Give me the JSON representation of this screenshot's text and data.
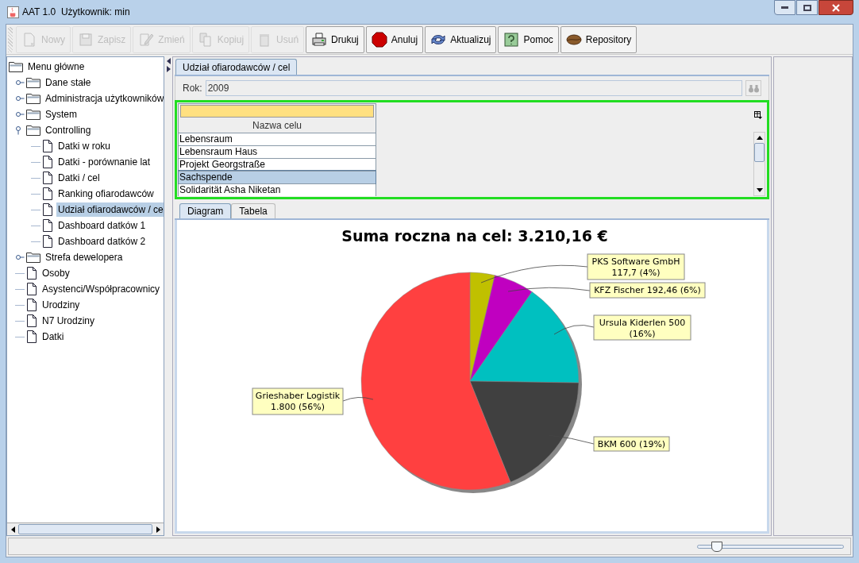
{
  "window": {
    "title": "AAT 1.0  Użytkownik: min"
  },
  "toolbar": [
    {
      "kind": "new",
      "label": "Nowy",
      "disabled": true
    },
    {
      "kind": "save",
      "label": "Zapisz",
      "disabled": true
    },
    {
      "kind": "edit",
      "label": "Zmień",
      "disabled": true
    },
    {
      "kind": "copy",
      "label": "Kopiuj",
      "disabled": true
    },
    {
      "kind": "delete",
      "label": "Usuń",
      "disabled": true
    },
    {
      "kind": "print",
      "label": "Drukuj",
      "disabled": false
    },
    {
      "kind": "cancel",
      "label": "Anuluj",
      "disabled": false
    },
    {
      "kind": "refresh",
      "label": "Aktualizuj",
      "disabled": false
    },
    {
      "kind": "help",
      "label": "Pomoc",
      "disabled": false
    },
    {
      "kind": "repo",
      "label": "Repository",
      "disabled": false
    }
  ],
  "sidebar": {
    "tree": {
      "label": "Menu główne",
      "kind": "folder",
      "selected": false,
      "children": [
        {
          "label": "Dane stałe",
          "kind": "folder",
          "expanded": false,
          "selected": false
        },
        {
          "label": "Administracja użytkowników",
          "kind": "folder",
          "expanded": false,
          "selected": false
        },
        {
          "label": "System",
          "kind": "folder",
          "expanded": false,
          "selected": false
        },
        {
          "label": "Controlling",
          "kind": "folder",
          "expanded": true,
          "selected": false,
          "children": [
            {
              "label": "Datki w roku",
              "kind": "doc",
              "selected": false
            },
            {
              "label": "Datki - porównanie lat",
              "kind": "doc",
              "selected": false
            },
            {
              "label": "Datki / cel",
              "kind": "doc",
              "selected": false
            },
            {
              "label": "Ranking ofiarodawców",
              "kind": "doc",
              "selected": false
            },
            {
              "label": "Udział ofiarodawców / ce",
              "kind": "doc",
              "selected": true
            },
            {
              "label": "Dashboard datków 1",
              "kind": "doc",
              "selected": false
            },
            {
              "label": "Dashboard datków 2",
              "kind": "doc",
              "selected": false
            }
          ]
        },
        {
          "label": "Strefa dewelopera",
          "kind": "folder",
          "expanded": false,
          "selected": false
        },
        {
          "label": "Osoby",
          "kind": "doc",
          "selected": false
        },
        {
          "label": "Asystenci/Współpracownicy",
          "kind": "doc",
          "selected": false
        },
        {
          "label": "Urodziny",
          "kind": "doc",
          "selected": false
        },
        {
          "label": "N7 Urodziny",
          "kind": "doc",
          "selected": false
        },
        {
          "label": "Datki",
          "kind": "doc",
          "selected": false
        }
      ]
    }
  },
  "document_tabs": [
    {
      "label": "Udział ofiarodawców / cel",
      "selected": true
    }
  ],
  "year_field": {
    "label": "Rok:",
    "value": "2009"
  },
  "table": {
    "column": "Nazwa celu",
    "rows": [
      {
        "name": "Lebensraum",
        "selected": false
      },
      {
        "name": "Lebensraum Haus",
        "selected": false
      },
      {
        "name": "Projekt Georgstraße",
        "selected": false
      },
      {
        "name": "Sachspende",
        "selected": true
      },
      {
        "name": "Solidarität Asha Niketan",
        "selected": false
      }
    ]
  },
  "view_tabs": [
    {
      "label": "Diagram",
      "selected": true
    },
    {
      "label": "Tabela",
      "selected": false
    }
  ],
  "chart_data": {
    "type": "pie",
    "title": "Suma roczna na cel: 3.210,16 €",
    "categories": [
      "PKS Software GmbH",
      "KFZ Fischer",
      "Ursula Kiderlen",
      "BKM",
      "Grieshaber Logistik"
    ],
    "series": [
      {
        "colors": [
          "#c0c000",
          "#c000c0",
          "#00c0c0",
          "#404040",
          "#ff4040"
        ],
        "values": [
          3.67,
          5.99,
          15.58,
          18.69,
          56.07
        ]
      }
    ],
    "value_labels": [
      "117,7 (4%)",
      "192,46 (6%)",
      "500 (16%)",
      "600 (19%)",
      "1.800 (56%)"
    ]
  },
  "zoom_slider": {
    "level": 0.13
  }
}
